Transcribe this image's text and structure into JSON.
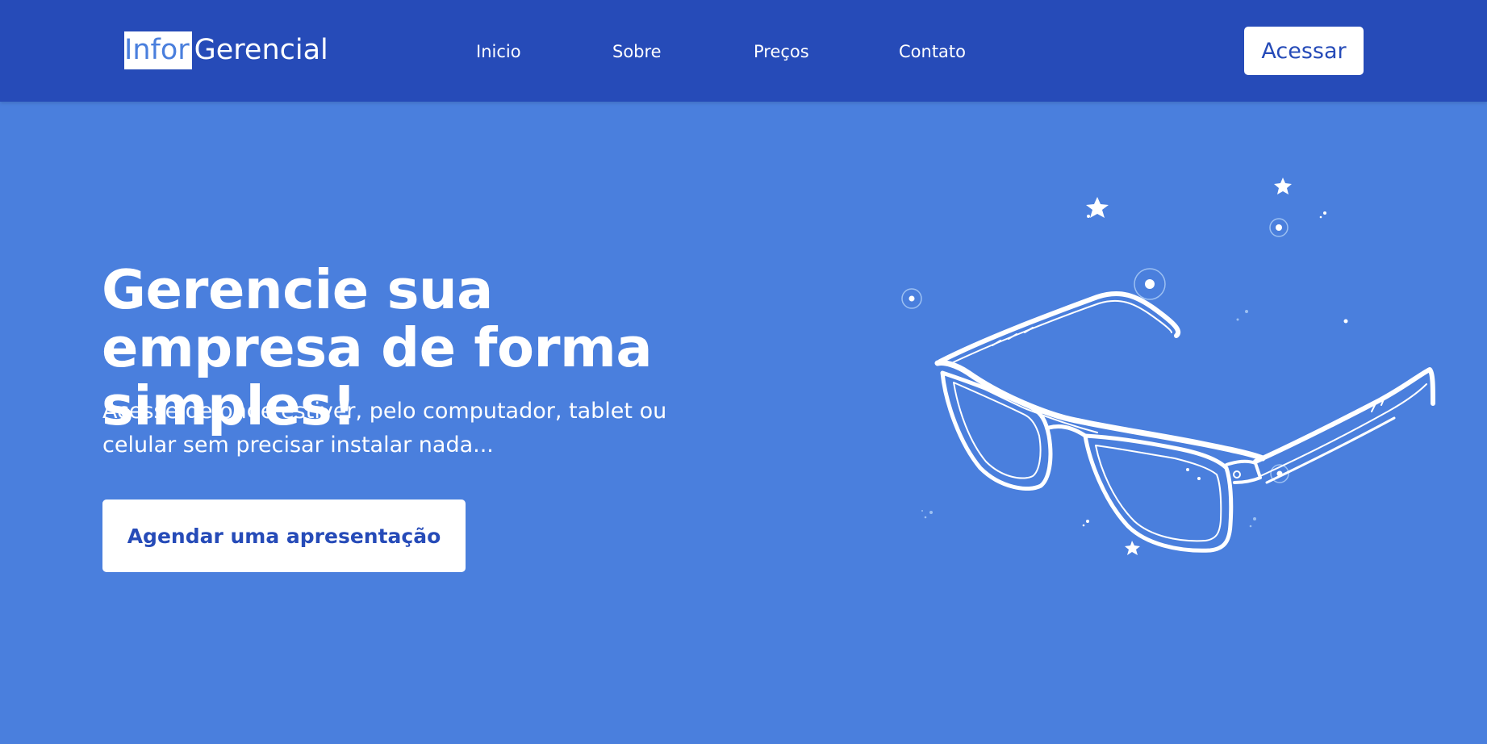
{
  "navbar": {
    "logo": {
      "highlight": "Infor",
      "rest": "Gerencial"
    },
    "links": [
      {
        "label": "Inicio"
      },
      {
        "label": "Sobre"
      },
      {
        "label": "Preços"
      },
      {
        "label": "Contato"
      }
    ],
    "access_button": "Acessar"
  },
  "hero": {
    "title": "Gerencie sua empresa de forma simples!",
    "subtitle": "Acesse de onde estiver, pelo computador, tablet ou celular sem precisar instalar nada...",
    "cta_button": "Agendar uma apresentação"
  },
  "illustration": {
    "icon": "eyeglasses-illustration"
  },
  "colors": {
    "navbar_bg": "#264bb8",
    "hero_bg": "#4a7fdd",
    "text": "#ffffff",
    "button_text": "#264bb8"
  }
}
